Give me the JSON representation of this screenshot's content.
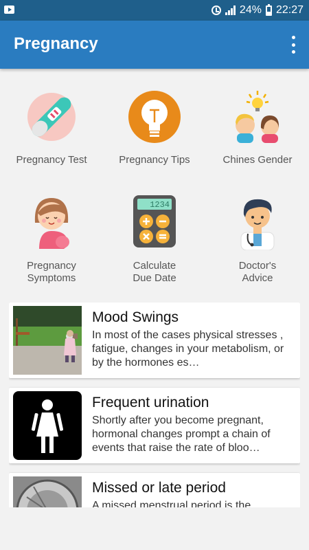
{
  "status_bar": {
    "battery": "24%",
    "time": "22:27"
  },
  "app_bar": {
    "title": "Pregnancy"
  },
  "tiles": [
    {
      "label": "Pregnancy Test",
      "icon": "pregnancy-test-icon"
    },
    {
      "label": "Pregnancy Tips",
      "icon": "lightbulb-icon"
    },
    {
      "label": "Chines Gender",
      "icon": "gender-couple-icon"
    },
    {
      "label": "Pregnancy\nSymptoms",
      "icon": "pregnant-woman-icon"
    },
    {
      "label": "Calculate\nDue Date",
      "icon": "calculator-icon"
    },
    {
      "label": "Doctor's\nAdvice",
      "icon": "doctor-icon"
    }
  ],
  "articles": [
    {
      "title": "Mood Swings",
      "text": "In most of the cases physical stresses , fatigue, changes in your metabolism, or by the hormones es…"
    },
    {
      "title": "Frequent urination",
      "text": "Shortly after you become pregnant, hormonal changes prompt a chain of events that raise the rate of bloo…"
    },
    {
      "title": "Missed or late period",
      "text": "A missed menstrual period is the"
    }
  ],
  "colors": {
    "status_bar": "#1f5f8b",
    "app_bar": "#2a7cc0",
    "background": "#f2f2f2"
  }
}
